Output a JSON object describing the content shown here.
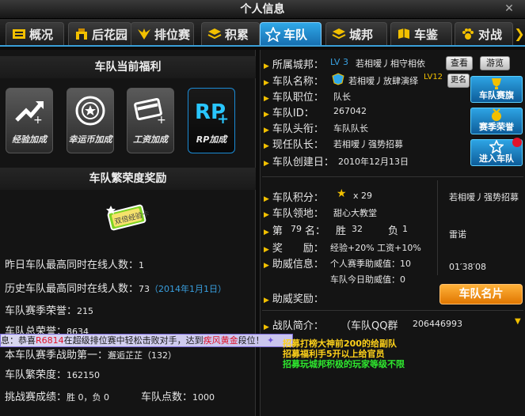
{
  "window": {
    "title": "个人信息"
  },
  "tabs": [
    {
      "label": "概况"
    },
    {
      "label": "后花园"
    },
    {
      "label": "排位赛"
    },
    {
      "label": "积累"
    },
    {
      "label": "车队"
    },
    {
      "label": "城邦"
    },
    {
      "label": "车鉴"
    },
    {
      "label": "对战"
    }
  ],
  "benefits": {
    "title": "车队当前福利",
    "items": [
      {
        "label": "经验加成"
      },
      {
        "label": "幸运币加成"
      },
      {
        "label": "工资加成"
      },
      {
        "label": "RP加成"
      }
    ]
  },
  "prosperity": {
    "title": "车队繁荣度奖励",
    "badge_text": "双倍经验卡"
  },
  "stats": {
    "yesterday_max_label": "昨日车队最高同时在线人数：",
    "yesterday_max_value": "1",
    "history_max_label": "历史车队最高同时在线人数：",
    "history_max_value": "73",
    "history_max_date": "（2014年1月1日）",
    "season_honor_label": "车队赛季荣誉：",
    "season_honor_value": "215",
    "total_honor_label": "车队总荣誉：",
    "total_honor_value": "8634",
    "season_first_label": "本车队赛季战助第一：",
    "season_first_value": "邂逅芷芷（132）",
    "prosperity_label": "车队繁荣度：",
    "prosperity_value": "162150",
    "challenge_label": "挑战赛成绩：",
    "challenge_value": "胜 0，负 0",
    "points_label": "车队点数：",
    "points_value": "1000"
  },
  "ticker": {
    "prefix": "息：恭喜",
    "name": "R6814",
    "middle": "在超级排位赛中轻松击败对手，达到",
    "rank": "疾风黄金",
    "suffix": "段位！"
  },
  "team_info": {
    "city_label": "所属城邦：",
    "city_level": "LV 3",
    "city_name": "若相嗳丿相守相依",
    "view_button": "查看",
    "tour_button": "游览",
    "name_label": "车队名称：",
    "name_value": "若相嗳丿放肆演绎",
    "name_level": "LV12",
    "rename_button": "更名",
    "position_label": "车队职位：",
    "position_value": "队长",
    "id_label": "车队ID：",
    "id_value": "267042",
    "title_label": "车队头衔：",
    "title_value": "车队队长",
    "leader_label": "现任队长：",
    "leader_value": "若相嗳丿强势招募",
    "created_label": "车队创建日：",
    "created_value": "2010年12月13日"
  },
  "side_buttons": [
    {
      "label": "车队赛旗"
    },
    {
      "label": "赛季荣誉"
    },
    {
      "label": "进入车队"
    }
  ],
  "team_detail": {
    "score_label": "车队积分：",
    "score_value": "x 29",
    "territory_label": "车队领地：",
    "territory_value": "甜心大教堂",
    "rank_prefix": "第",
    "rank_value": "79",
    "rank_suffix": "名：",
    "win_label": "胜",
    "win_value": "32",
    "lose_label": "负",
    "lose_value": "1",
    "reward_label": "奖　　励：",
    "reward_value": "经验+20% 工资+10%",
    "assist_label": "助威信息：",
    "assist_season": "个人赛季助威值：10",
    "assist_today": "车队今日助威值：0",
    "assist_reward_label": "助威奖励："
  },
  "side_info": {
    "player_name": "若相嗳丿强势招募",
    "nickname": "雷诺",
    "time": "01′38′08"
  },
  "card_button": "车队名片",
  "intro": {
    "label": "战队简介：",
    "qq_label": "（车队QQ群",
    "qq_value": "206446993",
    "recruit_lines": [
      "招募打榜大神前200的给副队",
      "招募福利手5开以上给官员",
      "招募玩城邦积极的玩家等级不限"
    ]
  },
  "colors": {
    "accent_blue": "#2fa8e8",
    "gold": "#f2c000",
    "orange": "#f08a00",
    "recruit_green": "#2ee82e",
    "recruit_gold": "#ffd21a",
    "link_blue": "#39a0e0"
  }
}
